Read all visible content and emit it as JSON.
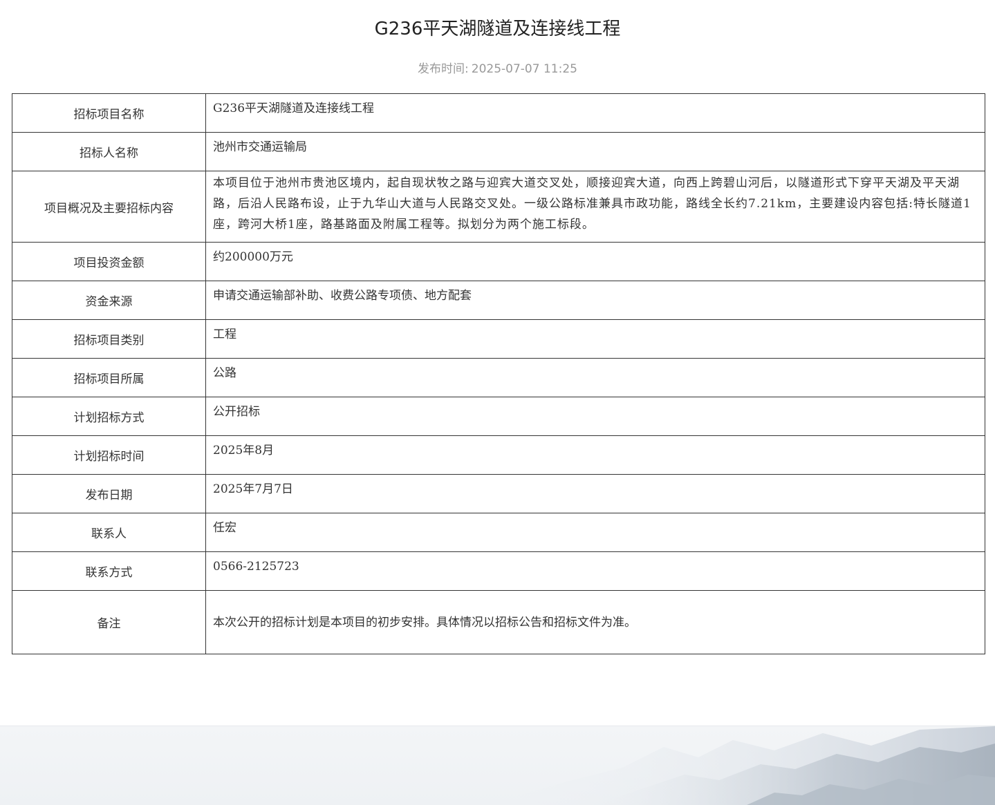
{
  "title": "G236平天湖隧道及连接线工程",
  "publish": {
    "label": "发布时间:",
    "value": "2025-07-07 11:25"
  },
  "rows": [
    {
      "label": "招标项目名称",
      "value": "G236平天湖隧道及连接线工程"
    },
    {
      "label": "招标人名称",
      "value": "池州市交通运输局"
    },
    {
      "label": "项目概况及主要招标内容",
      "value": "本项目位于池州市贵池区境内，起自现状牧之路与迎宾大道交叉处，顺接迎宾大道，向西上跨碧山河后，以隧道形式下穿平天湖及平天湖路，后沿人民路布设，止于九华山大道与人民路交叉处。一级公路标准兼具市政功能，路线全长约7.21km，主要建设内容包括:特长隧道1座，跨河大桥1座，路基路面及附属工程等。拟划分为两个施工标段。"
    },
    {
      "label": "项目投资金额",
      "value": "约200000万元"
    },
    {
      "label": "资金来源",
      "value": "申请交通运输部补助、收费公路专项债、地方配套"
    },
    {
      "label": "招标项目类别",
      "value": "工程"
    },
    {
      "label": "招标项目所属",
      "value": "公路"
    },
    {
      "label": "计划招标方式",
      "value": "公开招标"
    },
    {
      "label": "计划招标时间",
      "value": "2025年8月"
    },
    {
      "label": "发布日期",
      "value": "2025年7月7日"
    },
    {
      "label": "联系人",
      "value": "任宏"
    },
    {
      "label": "联系方式",
      "value": "0566-2125723"
    },
    {
      "label": "备注",
      "value": "本次公开的招标计划是本项目的初步安排。具体情况以招标公告和招标文件为准。"
    }
  ],
  "colors": {
    "border": "#333333",
    "muted_text": "#999999",
    "footer_bg": "#eef1f4"
  }
}
